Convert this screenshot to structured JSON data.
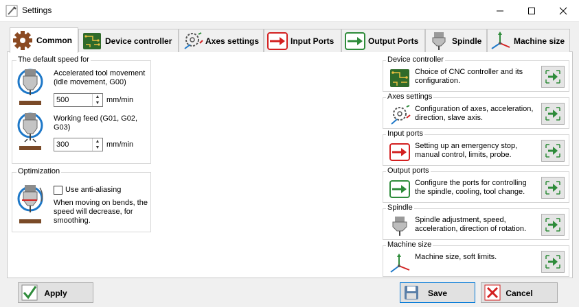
{
  "window": {
    "title": "Settings"
  },
  "tabs": [
    {
      "label": "Common",
      "icon": "gear-icon"
    },
    {
      "label": "Device controller",
      "icon": "circuit-board-icon"
    },
    {
      "label": "Axes settings",
      "icon": "axes-gear-icon"
    },
    {
      "label": "Input Ports",
      "icon": "arrow-in-icon"
    },
    {
      "label": "Output Ports",
      "icon": "arrow-out-icon"
    },
    {
      "label": "Spindle",
      "icon": "spindle-icon"
    },
    {
      "label": "Machine size",
      "icon": "xyz-axes-icon"
    }
  ],
  "speed": {
    "legend": "The default speed for",
    "accel_label": "Accelerated tool movement (idle movement, G00)",
    "accel_value": "500",
    "accel_unit": "mm/min",
    "feed_label": "Working feed (G01, G02, G03)",
    "feed_value": "300",
    "feed_unit": "mm/min"
  },
  "optimization": {
    "legend": "Optimization",
    "checkbox_label": "Use anti-aliasing",
    "checked": false,
    "description": "When moving on bends, the speed will decrease, for smoothing."
  },
  "sections": [
    {
      "legend": "Device controller",
      "text": "Choice of CNC controller and its configuration.",
      "icon": "circuit-board-icon"
    },
    {
      "legend": "Axes settings",
      "text": "Configuration of axes, acceleration, direction, slave axis.",
      "icon": "axes-gear-icon"
    },
    {
      "legend": "Input ports",
      "text": "Setting up an emergency stop, manual control, limits, probe.",
      "icon": "arrow-in-icon"
    },
    {
      "legend": "Output ports",
      "text": "Configure the ports for controlling the spindle, cooling, tool change.",
      "icon": "arrow-out-icon"
    },
    {
      "legend": "Spindle",
      "text": "Spindle adjustment, speed, acceleration, direction of rotation.",
      "icon": "spindle-icon"
    },
    {
      "legend": "Machine size",
      "text": "Machine size, soft limits.",
      "icon": "xyz-axes-icon"
    }
  ],
  "buttons": {
    "apply": "Apply",
    "save": "Save",
    "cancel": "Cancel"
  },
  "colors": {
    "accent_green": "#2e8b3a",
    "accent_red": "#d32020",
    "accent_blue": "#1e78c8",
    "board_green": "#2f6b2a"
  }
}
